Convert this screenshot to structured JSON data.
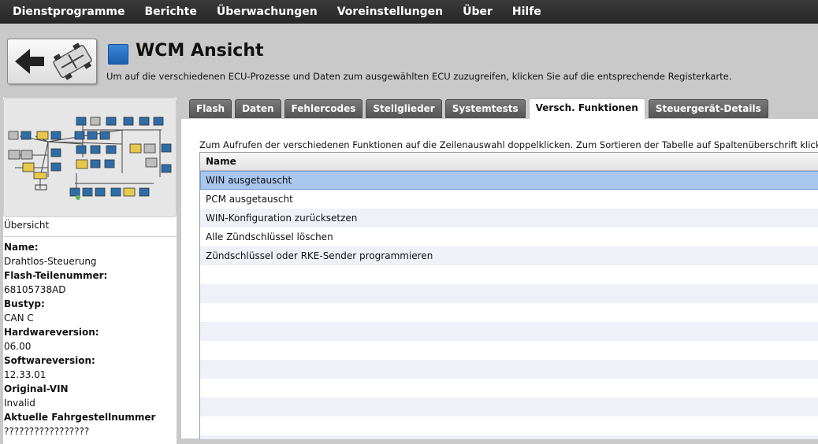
{
  "menu": {
    "items": [
      "Dienstprogramme",
      "Berichte",
      "Überwachungen",
      "Voreinstellungen",
      "Über",
      "Hilfe"
    ]
  },
  "header": {
    "title": "WCM Ansicht",
    "subtitle": "Um auf die verschiedenen ECU-Prozesse und Daten zum ausgewählten ECU zuzugreifen, klicken Sie auf die entsprechende Registerkarte.",
    "back_icon": "back-arrow-vehicle-icon",
    "title_icon": "blue-square-icon"
  },
  "tabs": [
    "Flash",
    "Daten",
    "Fehlercodes",
    "Stellglieder",
    "Systemtests",
    "Versch. Funktionen",
    "Steuergerät-Details"
  ],
  "active_tab": "Versch. Funktionen",
  "left_panel": {
    "diagram_icon": "network-topology-icon",
    "overview_label": "Übersicht",
    "info": [
      {
        "label": "Name:",
        "value": "Drahtlos-Steuerung"
      },
      {
        "label": "Flash-Teilenummer:",
        "value": "68105738AD"
      },
      {
        "label": "Bustyp:",
        "value": "CAN C"
      },
      {
        "label": "Hardwareversion:",
        "value": "06.00"
      },
      {
        "label": "Softwareversion:",
        "value": "12.33.01"
      },
      {
        "label": "Original-VIN",
        "value": "Invalid"
      },
      {
        "label": "Aktuelle Fahrgestellnummer",
        "value": "?????????????????"
      }
    ]
  },
  "content": {
    "instructions": "Zum Aufrufen der verschiedenen Funktionen auf die Zeilenauswahl doppelklicken.  Zum Sortieren der Tabelle auf Spaltenüberschrift klicken.",
    "column_header": "Name",
    "rows": [
      "WIN ausgetauscht",
      "PCM ausgetauscht",
      "WIN-Konfiguration zurücksetzen",
      "Alle Zündschlüssel löschen",
      "Zündschlüssel oder RKE-Sender programmieren"
    ],
    "selected_row": "WIN ausgetauscht"
  },
  "colors": {
    "menubar": "#2f2f2f",
    "background": "#c9c9c9",
    "tab_inactive": "#666666",
    "selection": "#a9c6ee",
    "ecu_blue": "#2e6ca8",
    "ecu_yellow": "#e6c84a",
    "ecu_gray": "#bdbdbd"
  }
}
